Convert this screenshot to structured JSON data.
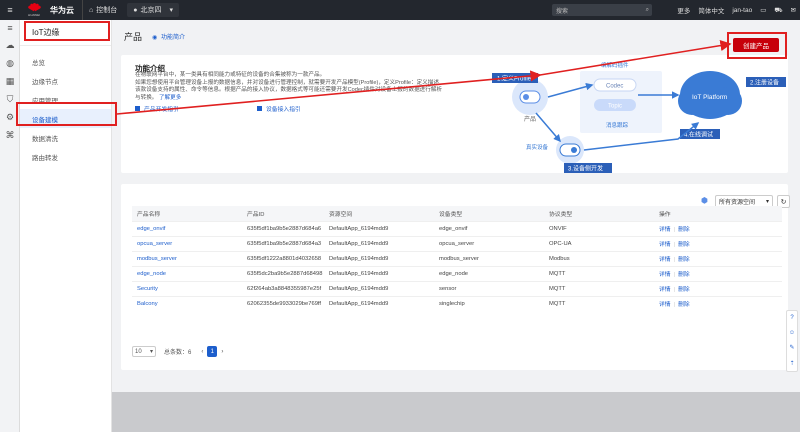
{
  "topbar": {
    "brand": "华为云",
    "console": "控制台",
    "region": "北京四",
    "search_placeholder": "搜索",
    "links": [
      "更多",
      "简体中文",
      "jan-tao"
    ]
  },
  "sidebar": {
    "title": "IoT边缘",
    "items": [
      {
        "label": "总览"
      },
      {
        "label": "边缘节点"
      },
      {
        "label": "应用管理"
      },
      {
        "label": "设备建模"
      },
      {
        "label": "数据清洗"
      },
      {
        "label": "路由转发"
      }
    ]
  },
  "page": {
    "title": "产品",
    "intro_link": "功能简介",
    "create_button": "创建产品"
  },
  "intro": {
    "title": "功能介绍",
    "desc_line1": "在物联网平台中，某一类具有相同能力或特征的设备的合集被称为一款产品。",
    "desc_line2": "如果您想使用平台管理设备上报的数据信息，并对设备进行管理控制，就需要开发产品模型(Profile)，定义Profile：定义描述该款设备支持的属性、命令等信息。根据产品的接入协议，数据格式等可能还需要开发Codec插件对设备上报的数据进行解析与转换。",
    "learn_more": "了解更多",
    "link_dev_guide": "产品开发指引",
    "link_device_guide": "设备接入指引",
    "diagram": {
      "step1": "1.定义Profile",
      "step2": "2.注册设备",
      "step3": "3.设备侧开发",
      "step4": "4.在线调试",
      "product": "产品",
      "codec": "Codec",
      "topic": "Topic",
      "codec_plugin": "编解码插件",
      "message_trace": "消息跟踪",
      "real_device": "真实设备",
      "platform": "IoT Platform"
    }
  },
  "table": {
    "filter": "所有资源空间",
    "columns": [
      "产品名称",
      "产品ID",
      "资源空间",
      "设备类型",
      "协议类型",
      "操作"
    ],
    "op_detail": "详情",
    "op_delete": "删除",
    "rows": [
      {
        "name": "edge_onvif",
        "id": "635f5df1ba9b5e2887d684a6",
        "space": "DefaultApp_6194mdd9",
        "type": "edge_onvif",
        "protocol": "ONVIF"
      },
      {
        "name": "opcua_server",
        "id": "635f5df1ba9b5e2887d684a3",
        "space": "DefaultApp_6194mdd9",
        "type": "opcua_server",
        "protocol": "OPC-UA"
      },
      {
        "name": "modbus_server",
        "id": "635f5df1222a8801d4032658",
        "space": "DefaultApp_6194mdd9",
        "type": "modbus_server",
        "protocol": "Modbus"
      },
      {
        "name": "edge_node",
        "id": "635f5dc2ba9b5e2887d68498",
        "space": "DefaultApp_6194mdd9",
        "type": "edge_node",
        "protocol": "MQTT"
      },
      {
        "name": "Security",
        "id": "62f264ab3a8848355987e25f",
        "space": "DefaultApp_6194mdd9",
        "type": "sensor",
        "protocol": "MQTT"
      },
      {
        "name": "Balcony",
        "id": "62062355de9933029be769ff",
        "space": "DefaultApp_6194mdd9",
        "type": "singlechip",
        "protocol": "MQTT"
      }
    ]
  },
  "pager": {
    "size": "10",
    "total": "总条数：6",
    "page": "1"
  },
  "colors": {
    "accent": "#1d5ecc",
    "brand_red": "#c7000b",
    "annotation_red": "#e02020"
  }
}
